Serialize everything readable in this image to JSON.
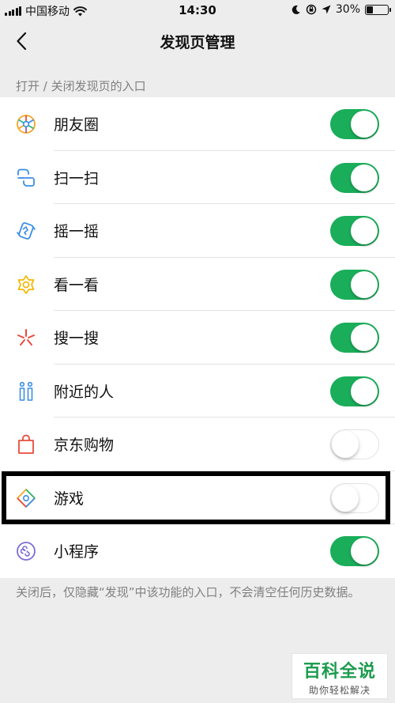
{
  "status_bar": {
    "carrier": "中国移动",
    "time": "14:30",
    "battery": "30%",
    "battery_level": 0.3
  },
  "nav": {
    "title": "发现页管理",
    "back_icon": "chevron-left-icon"
  },
  "section_header": "打开 / 关闭发现页的入口",
  "items": [
    {
      "label": "朋友圈",
      "icon": "moments-icon",
      "enabled": true
    },
    {
      "label": "扫一扫",
      "icon": "scan-icon",
      "enabled": true
    },
    {
      "label": "摇一摇",
      "icon": "shake-icon",
      "enabled": true
    },
    {
      "label": "看一看",
      "icon": "top-stories-icon",
      "enabled": true
    },
    {
      "label": "搜一搜",
      "icon": "search-sparkle-icon",
      "enabled": true
    },
    {
      "label": "附近的人",
      "icon": "people-nearby-icon",
      "enabled": true
    },
    {
      "label": "京东购物",
      "icon": "shopping-bag-icon",
      "enabled": false
    },
    {
      "label": "游戏",
      "icon": "games-icon",
      "enabled": false
    },
    {
      "label": "小程序",
      "icon": "mini-program-icon",
      "enabled": true
    }
  ],
  "footer_note": "关闭后，仅隐藏“发现”中该功能的入口，不会清空任何历史数据。",
  "watermark": {
    "title": "百科全说",
    "subtitle": "助你轻松解决"
  },
  "colors": {
    "toggle_on": "#1aad5a",
    "background": "#ededed",
    "secondary_text": "#808080"
  }
}
